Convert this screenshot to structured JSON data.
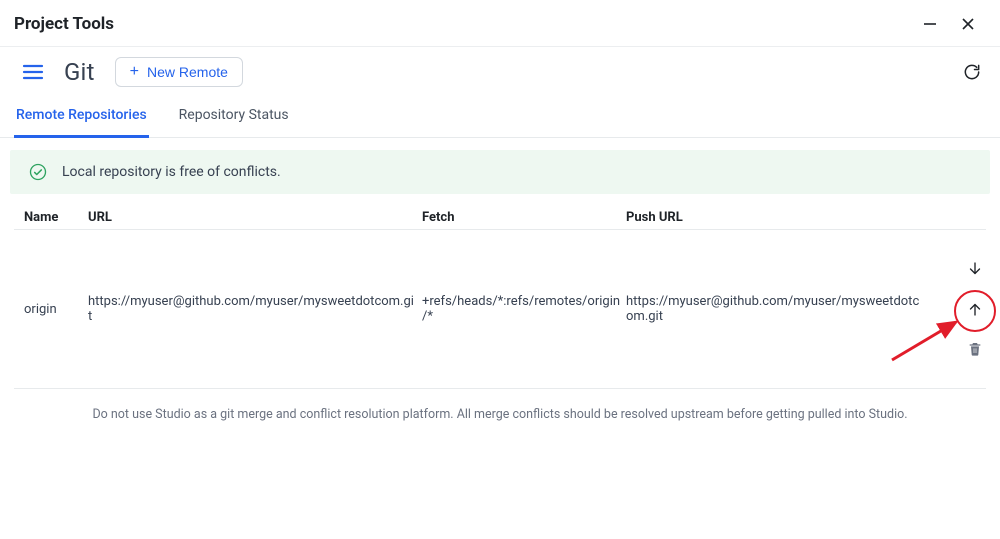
{
  "window": {
    "title": "Project Tools"
  },
  "toolbar": {
    "page_title": "Git",
    "new_remote_label": "New Remote"
  },
  "tabs": [
    {
      "label": "Remote Repositories",
      "active": true
    },
    {
      "label": "Repository Status",
      "active": false
    }
  ],
  "status": {
    "message": "Local repository is free of conflicts."
  },
  "table": {
    "columns": {
      "name": "Name",
      "url": "URL",
      "fetch": "Fetch",
      "push_url": "Push URL"
    },
    "rows": [
      {
        "name": "origin",
        "url": "https://myuser@github.com/myuser/mysweetdotcom.git",
        "fetch": "+refs/heads/*:refs/remotes/origin/*",
        "push_url": "https://myuser@github.com/myuser/mysweetdotcom.git"
      }
    ]
  },
  "footer": {
    "note": "Do not use Studio as a git merge and conflict resolution platform. All merge conflicts should be resolved upstream before getting pulled into Studio."
  }
}
